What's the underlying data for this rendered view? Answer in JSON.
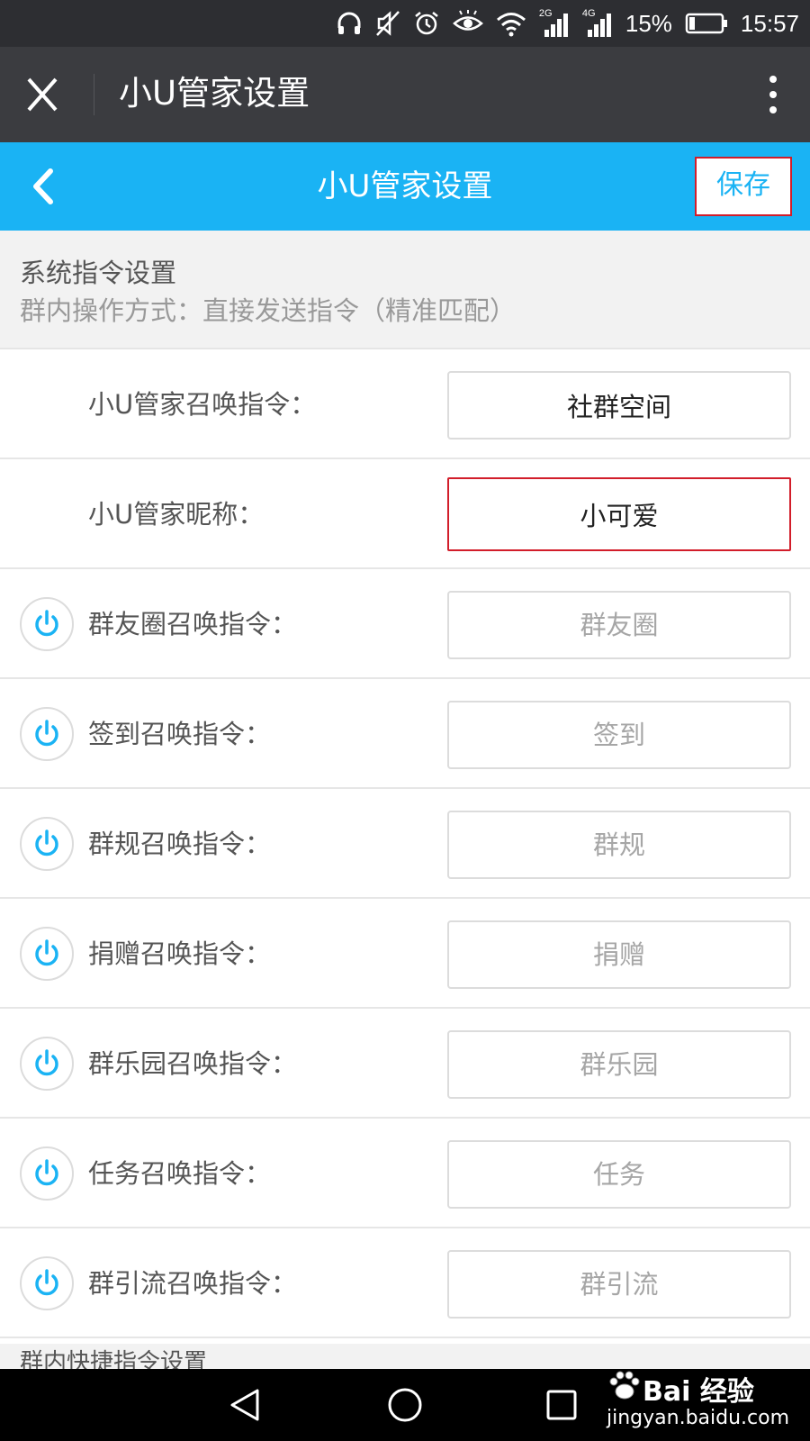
{
  "status_bar": {
    "battery_percent": "15%",
    "time": "15:57",
    "network_2g": "2G",
    "network_4g": "4G",
    "icons": [
      "headphones-icon",
      "mute-icon",
      "alarm-icon",
      "eye-icon",
      "wifi-icon",
      "signal-2g-icon",
      "signal-4g-icon",
      "battery-icon"
    ]
  },
  "wechat_bar": {
    "title": "小U管家设置",
    "close_icon": "close-icon",
    "more_icon": "more-vertical-icon"
  },
  "nav": {
    "title": "小U管家设置",
    "save_label": "保存",
    "back_icon": "chevron-left-icon"
  },
  "section": {
    "title": "系统指令设置",
    "subtitle": "群内操作方式：直接发送指令（精准匹配）"
  },
  "rows": [
    {
      "label": "小U管家召唤指令：",
      "value": "社群空间",
      "placeholder": ""
    },
    {
      "label": "小U管家昵称：",
      "value": "小可爱",
      "placeholder": ""
    },
    {
      "label": "群友圈召唤指令：",
      "value": "",
      "placeholder": "群友圈"
    },
    {
      "label": "签到召唤指令：",
      "value": "",
      "placeholder": "签到"
    },
    {
      "label": "群规召唤指令：",
      "value": "",
      "placeholder": "群规"
    },
    {
      "label": "捐赠召唤指令：",
      "value": "",
      "placeholder": "捐赠"
    },
    {
      "label": "群乐园召唤指令：",
      "value": "",
      "placeholder": "群乐园"
    },
    {
      "label": "任务召唤指令：",
      "value": "",
      "placeholder": "任务"
    },
    {
      "label": "群引流召唤指令：",
      "value": "",
      "placeholder": "群引流"
    }
  ],
  "next_section": {
    "title_partial": "群内快捷指令设置"
  },
  "colors": {
    "accent": "#1ab3f4",
    "highlight": "#d21d2a",
    "status_bar": "#2d2e32",
    "wechat_bar": "#3b3c40"
  },
  "watermark": {
    "brand": "Bai 经验",
    "url": "jingyan.baidu.com"
  }
}
